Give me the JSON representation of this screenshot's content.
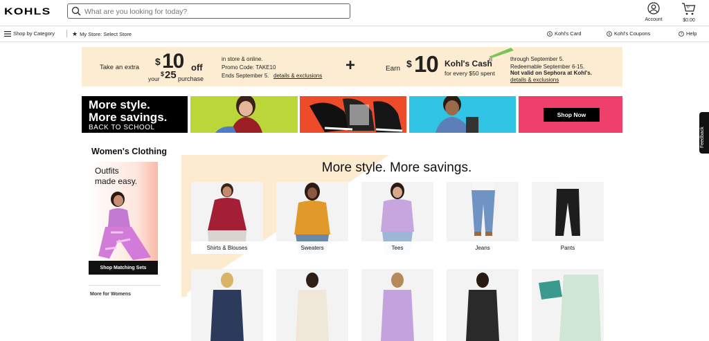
{
  "header": {
    "logo": "KOHLS",
    "search_placeholder": "What are you looking for today?",
    "account_label": "Account",
    "cart_count": "0",
    "cart_total": "$0.00"
  },
  "subnav": {
    "shop_by_category": "Shop by Category",
    "my_store": "My Store: Select Store",
    "kohls_card": "Kohl's Card",
    "kohls_coupons": "Kohl's Coupons",
    "help": "Help"
  },
  "promo": {
    "take_an_extra": "Take an extra",
    "dollar1": "$",
    "amount1": "10",
    "off": "off",
    "your": "your",
    "dollar25": "$",
    "amount25": "25",
    "purchase": "purchase",
    "line1": "in store & online.",
    "line2": "Promo Code: TAKE10",
    "line3": "Ends September 5.",
    "details1": "details & exclusions",
    "plus": "+",
    "earn": "Earn",
    "dollar2": "$",
    "amount2": "10",
    "kohls_cash": "Kohl's Cash",
    "reg": "®",
    "for_every": "for every $50 spent",
    "r1": "through September 5.",
    "r2": "Redeemable September 6-15.",
    "r3": "Not valid on Sephora at Kohl's.",
    "details2": "details & exclusions"
  },
  "banner": {
    "l1": "More style.",
    "l2": "More savings.",
    "l3": "BACK TO SCHOOL",
    "shop_now": "Shop Now"
  },
  "sidebar": {
    "title": "Women's Clothing",
    "card_text1": "Outfits",
    "card_text2": "made easy.",
    "card_button": "Shop Matching Sets",
    "more": "More for Womens"
  },
  "main": {
    "heading": "More style. More savings.",
    "categories": [
      {
        "label": "Shirts & Blouses"
      },
      {
        "label": "Sweaters"
      },
      {
        "label": "Tees"
      },
      {
        "label": "Jeans"
      },
      {
        "label": "Pants"
      }
    ]
  },
  "feedback": "Feedback"
}
